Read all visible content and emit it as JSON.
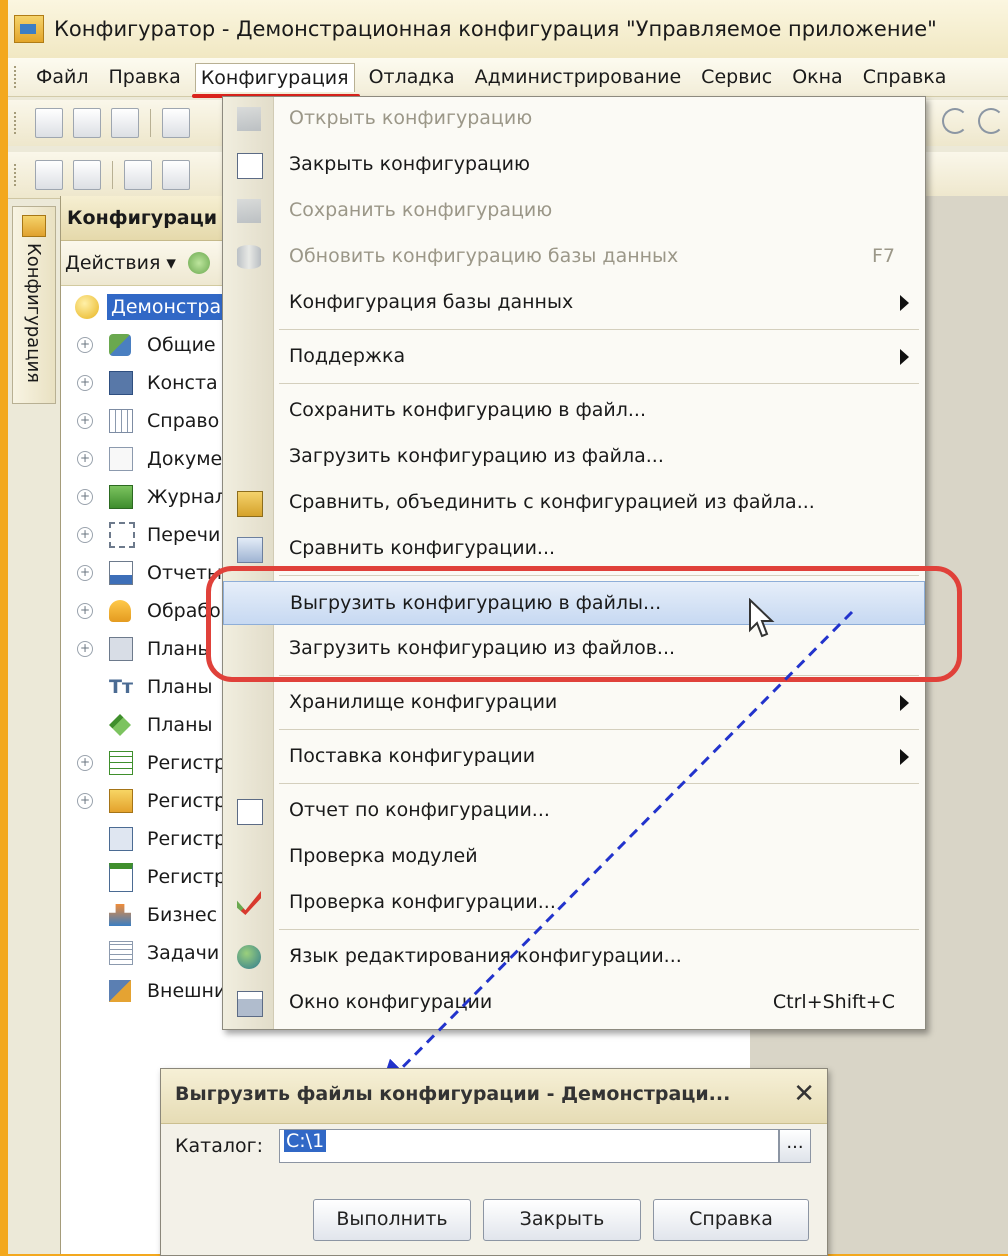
{
  "window": {
    "title": "Конфигуратор - Демонстрационная конфигурация \"Управляемое приложение\""
  },
  "menubar": {
    "items": [
      "Файл",
      "Правка",
      "Конфигурация",
      "Отладка",
      "Администрирование",
      "Сервис",
      "Окна",
      "Справка"
    ],
    "active": "Конфигурация"
  },
  "sidetab": {
    "label": "Конфигурация"
  },
  "panel": {
    "title": "Конфигураци",
    "actions_label": "Действия ▾",
    "root_label": "Демонстра",
    "tree": [
      "Общие",
      "Конста",
      "Справо",
      "Докуме",
      "Журнал",
      "Перечи",
      "Отчеты",
      "Обрабо",
      "Планы",
      "Планы",
      "Планы",
      "Регистр",
      "Регистр",
      "Регистр",
      "Регистр",
      "Бизнес",
      "Задачи",
      "Внешни"
    ]
  },
  "dropdown": {
    "items": [
      {
        "label": "Открыть конфигурацию",
        "shortcut": "",
        "disabled": true,
        "submenu": false,
        "icon": "open-config-icon"
      },
      {
        "label": "Закрыть конфигурацию",
        "shortcut": "",
        "disabled": false,
        "submenu": false,
        "icon": "close-config-icon"
      },
      {
        "label": "Сохранить конфигурацию",
        "shortcut": "",
        "disabled": true,
        "submenu": false,
        "icon": "save-config-icon"
      },
      {
        "label": "Обновить конфигурацию базы данных",
        "shortcut": "F7",
        "disabled": true,
        "submenu": false,
        "icon": "update-db-icon"
      },
      {
        "label": "Конфигурация базы данных",
        "shortcut": "",
        "disabled": false,
        "submenu": true,
        "icon": ""
      },
      {
        "label": "Поддержка",
        "shortcut": "",
        "disabled": false,
        "submenu": true,
        "icon": ""
      },
      {
        "label": "Сохранить конфигурацию в файл...",
        "shortcut": "",
        "disabled": false,
        "submenu": false,
        "icon": ""
      },
      {
        "label": "Загрузить конфигурацию из файла...",
        "shortcut": "",
        "disabled": false,
        "submenu": false,
        "icon": ""
      },
      {
        "label": "Сравнить, объединить с конфигурацией из файла...",
        "shortcut": "",
        "disabled": false,
        "submenu": false,
        "icon": "compare-merge-icon"
      },
      {
        "label": "Сравнить конфигурации...",
        "shortcut": "",
        "disabled": false,
        "submenu": false,
        "icon": "compare-icon"
      },
      {
        "label": "Выгрузить конфигурацию в файлы...",
        "shortcut": "",
        "disabled": false,
        "submenu": false,
        "icon": ""
      },
      {
        "label": "Загрузить конфигурацию из файлов...",
        "shortcut": "",
        "disabled": false,
        "submenu": false,
        "icon": ""
      },
      {
        "label": "Хранилище конфигурации",
        "shortcut": "",
        "disabled": false,
        "submenu": true,
        "icon": ""
      },
      {
        "label": "Поставка конфигурации",
        "shortcut": "",
        "disabled": false,
        "submenu": true,
        "icon": ""
      },
      {
        "label": "Отчет по конфигурации...",
        "shortcut": "",
        "disabled": false,
        "submenu": false,
        "icon": "report-icon"
      },
      {
        "label": "Проверка модулей",
        "shortcut": "",
        "disabled": false,
        "submenu": false,
        "icon": ""
      },
      {
        "label": "Проверка конфигурации...",
        "shortcut": "",
        "disabled": false,
        "submenu": false,
        "icon": "check-config-icon"
      },
      {
        "label": "Язык редактирования конфигурации...",
        "shortcut": "",
        "disabled": false,
        "submenu": false,
        "icon": "language-icon"
      },
      {
        "label": "Окно конфигурации",
        "shortcut": "Ctrl+Shift+C",
        "disabled": false,
        "submenu": false,
        "icon": "config-window-icon"
      }
    ],
    "highlighted": "Выгрузить конфигурацию в файлы..."
  },
  "dialog": {
    "title": "Выгрузить файлы конфигурации - Демонстраци...",
    "catalog_label": "Каталог:",
    "catalog_value": "C:\\1",
    "browse_label": "...",
    "run_label": "Выполнить",
    "close_label": "Закрыть",
    "help_label": "Справка"
  }
}
